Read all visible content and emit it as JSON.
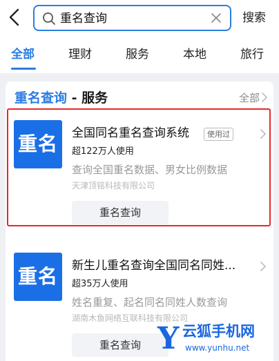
{
  "search": {
    "query": "重名查询",
    "submit_label": "搜索"
  },
  "tabs": [
    {
      "label": "全部",
      "active": true
    },
    {
      "label": "理财"
    },
    {
      "label": "服务"
    },
    {
      "label": "本地"
    },
    {
      "label": "旅行"
    }
  ],
  "section": {
    "title_highlight": "重名查询",
    "title_rest": " - 服务",
    "all_label": "全部"
  },
  "results": [
    {
      "logo_text": "重名",
      "name": "全国同名重名查询系统",
      "badge": "使用过",
      "users": "超122万人使用",
      "desc": "查询全国重名数据、男女比例数据",
      "company": "天津顶铭科技有限公司",
      "action": "重名查询"
    },
    {
      "logo_text": "重名",
      "name": "新生儿重名查询全国同名同姓...",
      "users": "超35万人使用",
      "desc": "姓名重复、起名同名同姓人数查询",
      "company": "湖南木鱼网络互联科技有限公司",
      "action": "重名查询"
    }
  ],
  "watermark": {
    "letter": "Y",
    "name": "云狐手机网",
    "url": "www.yunhu.net"
  },
  "colors": {
    "accent": "#2a7de1",
    "logo_bg": "#1b6fe6",
    "highlight_border": "#e8262b"
  }
}
